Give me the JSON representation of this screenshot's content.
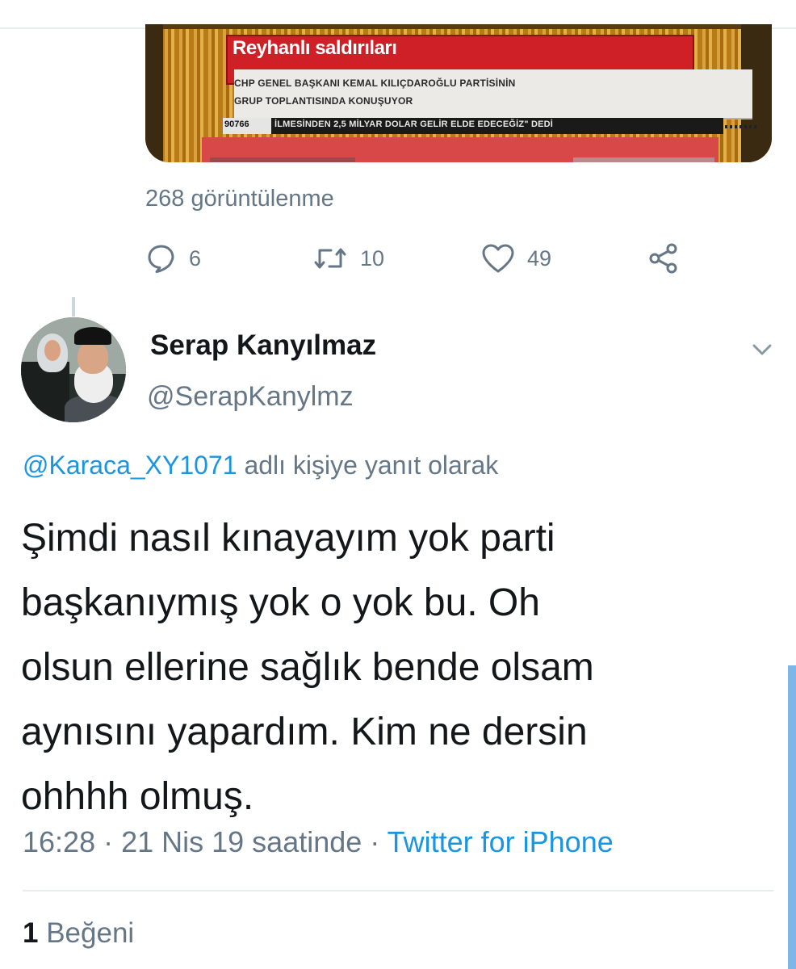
{
  "media": {
    "banner_title": "Reyhanlı saldırıları",
    "banner_line1": "CHP GENEL BAŞKANI KEMAL KILIÇDAROĞLU PARTİSİNİN",
    "banner_line2": "GRUP TOPLANTISINDA KONUŞUYOR",
    "ticker_number": "90766",
    "ticker_text": "İLMESİNDEN 2,5 MİLYAR DOLAR GELİR ELDE EDECEĞİZ\" DEDİ"
  },
  "prev_tweet": {
    "views": "268 görüntülenme",
    "actions": {
      "reply_count": "6",
      "retweet_count": "10",
      "like_count": "49"
    }
  },
  "tweet": {
    "display_name": "Serap Kanyılmaz",
    "handle": "@SerapKanylmz",
    "reply_mention": "@Karaca_XY1071",
    "reply_suffix": "adlı kişiye yanıt olarak",
    "text_lines": [
      "Şimdi nasıl kınayayım yok parti",
      "başkanıymış yok o yok bu. Oh",
      "olsun ellerine sağlık bende olsam",
      "aynısını yapardım. Kim ne dersin",
      "ohhhh olmuş."
    ],
    "time": "16:28 · 21 Nis 19 saatinde ·",
    "source": "Twitter for iPhone",
    "like_count": "1",
    "like_label": "Beğeni"
  },
  "colors": {
    "accent": "#1b95e0",
    "secondary_text": "#657786",
    "primary_text": "#14171a",
    "divider": "#e6ecf0"
  }
}
